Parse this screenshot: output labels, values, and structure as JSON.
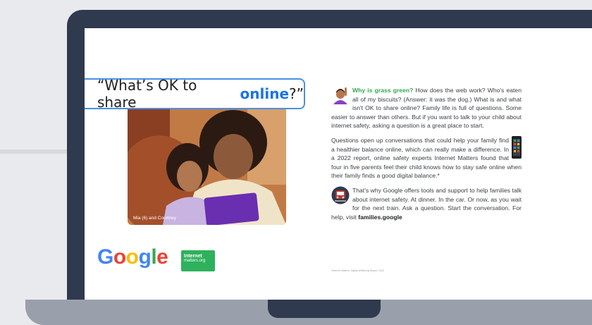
{
  "ad": {
    "heading_before": "“What’s OK to share ",
    "heading_highlight": "online",
    "heading_after": "?”",
    "photo_caption": "Mia (6) and Courtney",
    "paragraph1": {
      "lead": "Why is grass green?",
      "text": " How does the web work? Who's eaten all of my biscuits? (Answer: it was the dog.) What is and what isn't OK to share online? Family life is full of questions. Some easier to answer than others. But if you want to talk to your child about internet safety, asking a question is a great place to start."
    },
    "paragraph2": "Questions open up conversations that could help your family find a healthier balance online, which can really make a difference. In a 2022 report, online safety experts Internet Matters found that four in five parents feel their child knows how to stay safe online when their family finds a good digital balance.*",
    "paragraph3": {
      "text": "That's why Google offers tools and support to help families talk about internet safety. At dinner. In the car. Or now, as you wait for the next train. Ask a question. Start the conversation. For help, visit ",
      "link": "families.google"
    },
    "footnote": "*Internet Matters, Digital Wellbeing Report, 2022",
    "google_logo": [
      "G",
      "o",
      "o",
      "g",
      "l",
      "e"
    ],
    "internet_matters_logo": {
      "line1": "Internet",
      "line2": "matters.org"
    }
  },
  "icons": {
    "emoji_person": "person-raising-hand-icon",
    "phone": "phone-icon",
    "train": "train-icon"
  },
  "colors": {
    "bezel": "#2f3a4f",
    "base": "#9aa0ab",
    "accent_blue": "#1a73e8",
    "accent_green": "#34A853",
    "box_border": "#4a90e2"
  }
}
